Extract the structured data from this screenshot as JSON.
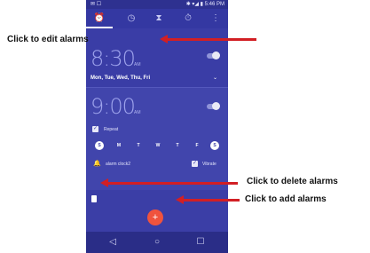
{
  "status_bar": {
    "left": "✉ ☐",
    "right": "✱ ▾◢ ▮ 5:46 PM"
  },
  "tabs": [
    {
      "name": "alarm",
      "icon": "alarm-clock-icon",
      "glyph": "⏰"
    },
    {
      "name": "clock",
      "icon": "clock-icon",
      "glyph": "◷"
    },
    {
      "name": "timer",
      "icon": "hourglass-icon",
      "glyph": "⧗"
    },
    {
      "name": "stopwatch",
      "icon": "stopwatch-icon",
      "glyph": "⏱"
    },
    {
      "name": "more",
      "icon": "overflow-menu-icon",
      "glyph": "⋮"
    }
  ],
  "alarms": [
    {
      "time": "8:30",
      "ampm": "AM",
      "days": "Mon, Tue, Wed, Thu, Fri",
      "enabled": true
    },
    {
      "time": "9:00",
      "ampm": "AM",
      "enabled": true,
      "repeat_label": "Repeat",
      "weekdays": [
        "S",
        "M",
        "T",
        "W",
        "T",
        "F",
        "S"
      ],
      "weekdays_on": [
        true,
        false,
        false,
        false,
        false,
        false,
        true
      ],
      "ringtone": "alarm clock2",
      "vibrate_label": "Vibrate"
    }
  ],
  "controls": {
    "fab": "+",
    "check": "✓",
    "chevron": "⌄",
    "bell": "🔔"
  },
  "nav": {
    "back": "◁",
    "home": "○",
    "recents": "☐"
  },
  "annotations": {
    "edit": "Click to edit alarms",
    "delete": "Click to delete alarms",
    "add": "Click to add alarms"
  },
  "colors": {
    "app_bg": "#3b3ea6",
    "fab": "#f0533d",
    "arrow": "#d21f24"
  }
}
